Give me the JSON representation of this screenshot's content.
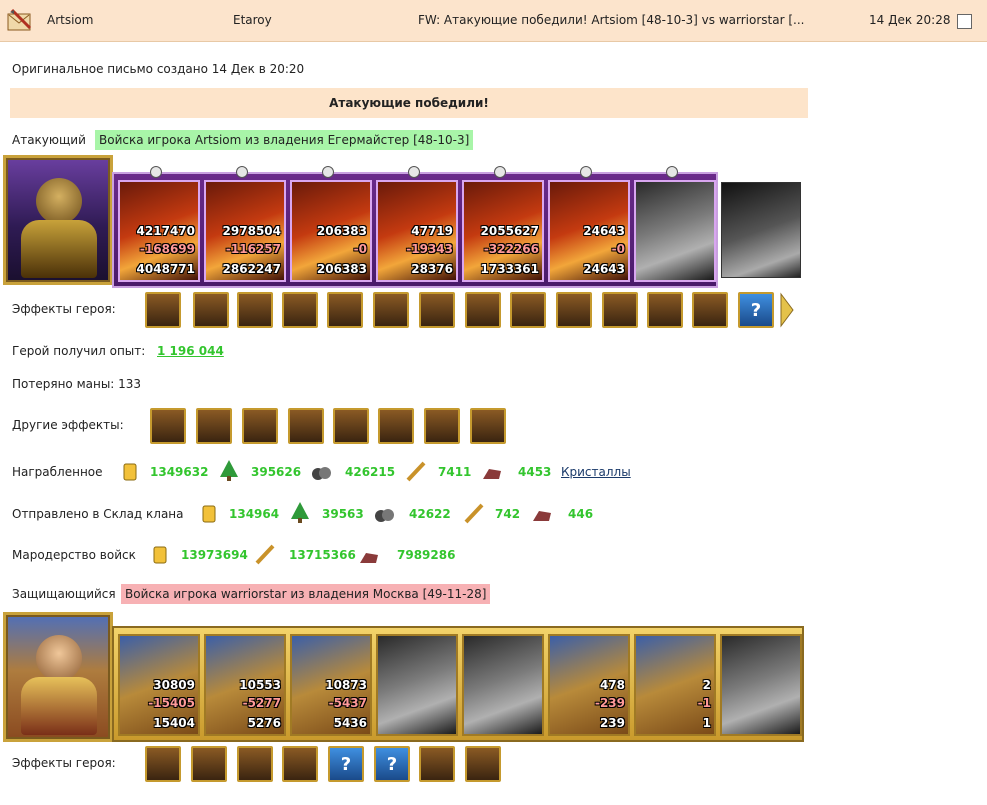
{
  "header": {
    "sender": "Artsiom",
    "recipient": "Etaroy",
    "subject": "FW: Атакующие победили! Artsiom [48-10-3] vs warriorstar [...",
    "date": "14 Дек 20:28"
  },
  "original_note": "Оригинальное письмо создано 14 Дек в 20:20",
  "result_banner": "Атакующие победили!",
  "attacker": {
    "label": "Атакующий",
    "army": "Войска игрока Artsiom из владения Егермайстер [48-10-3]",
    "units": [
      {
        "top": "4217470",
        "loss": "-168699",
        "bottom": "4048771"
      },
      {
        "top": "2978504",
        "loss": "-116257",
        "bottom": "2862247"
      },
      {
        "top": "206383",
        "loss": "-0",
        "bottom": "206383"
      },
      {
        "top": "47719",
        "loss": "-19343",
        "bottom": "28376"
      },
      {
        "top": "2055627",
        "loss": "-322266",
        "bottom": "1733361"
      },
      {
        "top": "24643",
        "loss": "-0",
        "bottom": "24643"
      },
      {
        "top": "",
        "loss": "",
        "bottom": ""
      }
    ]
  },
  "hero_effects_label": "Эффекты героя:",
  "experience": {
    "label": "Герой получил опыт:",
    "value": "1 196 044"
  },
  "mana": {
    "label": "Потеряно маны: 133"
  },
  "other_effects_label": "Другие эффекты:",
  "loot": {
    "label": "Награбленное",
    "values": [
      "1349632",
      "395626",
      "426215",
      "7411",
      "4453"
    ],
    "crystals_link": "Кристаллы"
  },
  "clan_storage": {
    "label": "Отправлено в Склад клана",
    "values": [
      "134964",
      "39563",
      "42622",
      "742",
      "446"
    ]
  },
  "marauding": {
    "label": "Мародерство войск",
    "values": [
      "13973694",
      "13715366",
      "7989286"
    ]
  },
  "defender": {
    "label": "Защищающийся",
    "army": "Войска игрока warriorstar из владения Москва [49-11-28]",
    "units": [
      {
        "top": "30809",
        "loss": "-15405",
        "bottom": "15404"
      },
      {
        "top": "10553",
        "loss": "-5277",
        "bottom": "5276"
      },
      {
        "top": "10873",
        "loss": "-5437",
        "bottom": "5436"
      },
      {
        "top": "",
        "loss": "",
        "bottom": ""
      },
      {
        "top": "",
        "loss": "",
        "bottom": ""
      },
      {
        "top": "478",
        "loss": "-239",
        "bottom": "239"
      },
      {
        "top": "2",
        "loss": "-1",
        "bottom": "1"
      }
    ]
  },
  "defender_effects_label": "Эффекты героя:",
  "icons": {
    "gold": "gold-coins-icon",
    "wood": "wood-tree-icon",
    "ore": "ore-icon",
    "crops": "wheat-icon",
    "stone": "stone-icon",
    "question": "?"
  },
  "colors": {
    "header_bg": "#fce4cc",
    "banner_bg": "#fde4ca",
    "attacker_tag": "#a8f5a8",
    "defender_tag": "#f7b1b4",
    "resource_value": "#33c52e"
  }
}
